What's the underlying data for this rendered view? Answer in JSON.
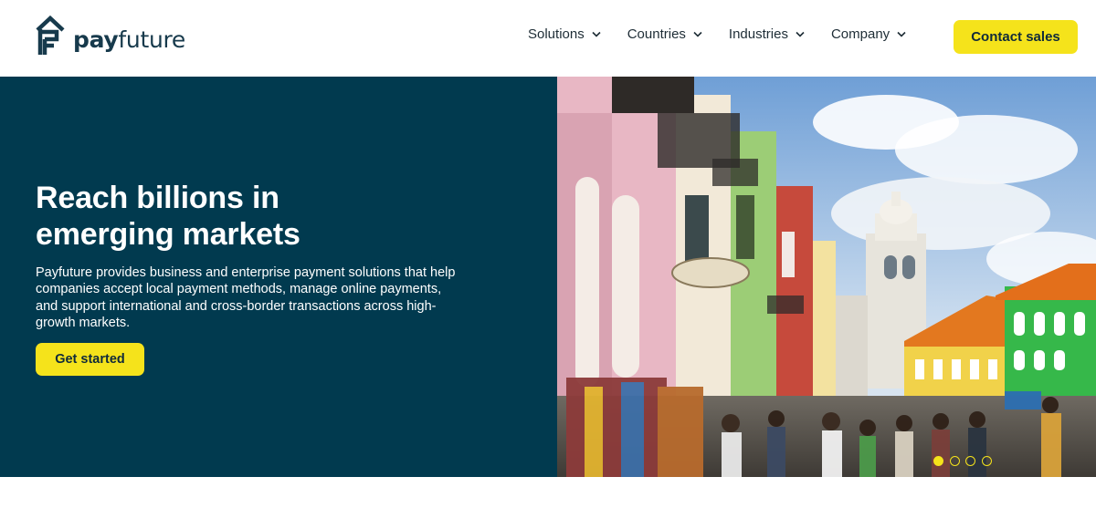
{
  "brand": {
    "name_bold": "pay",
    "name_rest": "future",
    "logo_icon": "payfuture-logo-icon"
  },
  "nav": {
    "items": [
      {
        "label": "Solutions",
        "icon": "chevron-down-icon"
      },
      {
        "label": "Countries",
        "icon": "chevron-down-icon"
      },
      {
        "label": "Industries",
        "icon": "chevron-down-icon"
      },
      {
        "label": "Company",
        "icon": "chevron-down-icon"
      }
    ],
    "contact_label": "Contact sales"
  },
  "hero": {
    "title_line1": "Reach billions in",
    "title_line2": "emerging markets",
    "description": "Payfuture provides business and enterprise payment solutions that help companies accept local payment methods, manage online payments, and support international and cross-border transactions across high-growth markets.",
    "cta_label": "Get started",
    "image_subject": "colorful-colonial-street-photo",
    "slides": {
      "count": 4,
      "active": 1
    }
  },
  "colors": {
    "accent": "#f5e31b",
    "hero_bg": "#013a4f",
    "brand_text": "#173a4c"
  }
}
